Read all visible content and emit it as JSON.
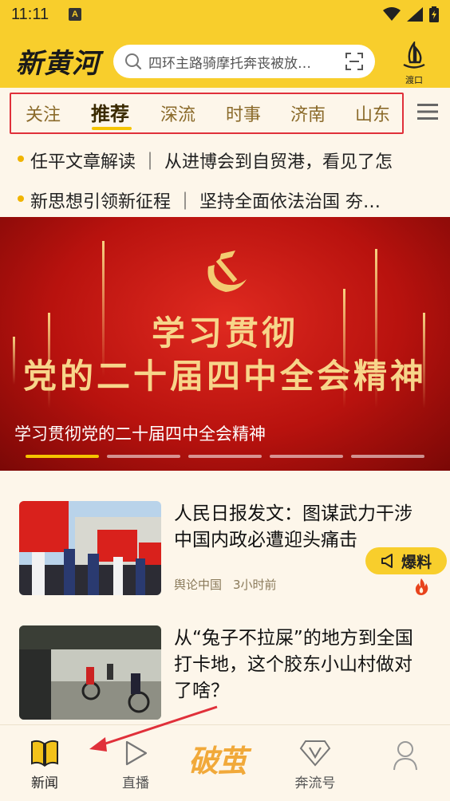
{
  "status_bar": {
    "time": "11:11",
    "app_badge": "A"
  },
  "header": {
    "logo": "新黄河",
    "search": {
      "query": "四环主路骑摩托奔丧被放…"
    },
    "dukou_label": "渡口"
  },
  "tabs": [
    {
      "label": "关注",
      "active": false
    },
    {
      "label": "推荐",
      "active": true
    },
    {
      "label": "深流",
      "active": false
    },
    {
      "label": "时事",
      "active": false
    },
    {
      "label": "济南",
      "active": false
    },
    {
      "label": "山东",
      "active": false
    }
  ],
  "ticker": [
    "任平文章解读 ｜ 从进博会到自贸港，看见了怎",
    "新思想引领新征程 ｜ 坚持全面依法治国 夯…"
  ],
  "banner": {
    "headline_line1": "学习贯彻",
    "headline_line2": "党的二十届四中全会精神",
    "caption": "学习贯彻党的二十届四中全会精神",
    "page_count": 5,
    "active_page": 0
  },
  "news": [
    {
      "title": "人民日报发文：图谋武力干涉中国内政必遭迎头痛击",
      "source": "舆论中国",
      "time": "3小时前"
    },
    {
      "title": "从“兔子不拉屎”的地方到全国打卡地，这个胶东小山村做对了啥？",
      "source": "",
      "time": ""
    }
  ],
  "baoliao_label": "爆料",
  "bottom_nav": [
    {
      "label": "新闻",
      "active": true
    },
    {
      "label": "直播",
      "active": false
    },
    {
      "label": "破茧",
      "active": false
    },
    {
      "label": "奔流号",
      "active": false
    },
    {
      "label": "",
      "active": false
    }
  ],
  "colors": {
    "brand_yellow": "#f8ce2c",
    "annotation_red": "#e0303a",
    "banner_red": "#c8160f"
  }
}
